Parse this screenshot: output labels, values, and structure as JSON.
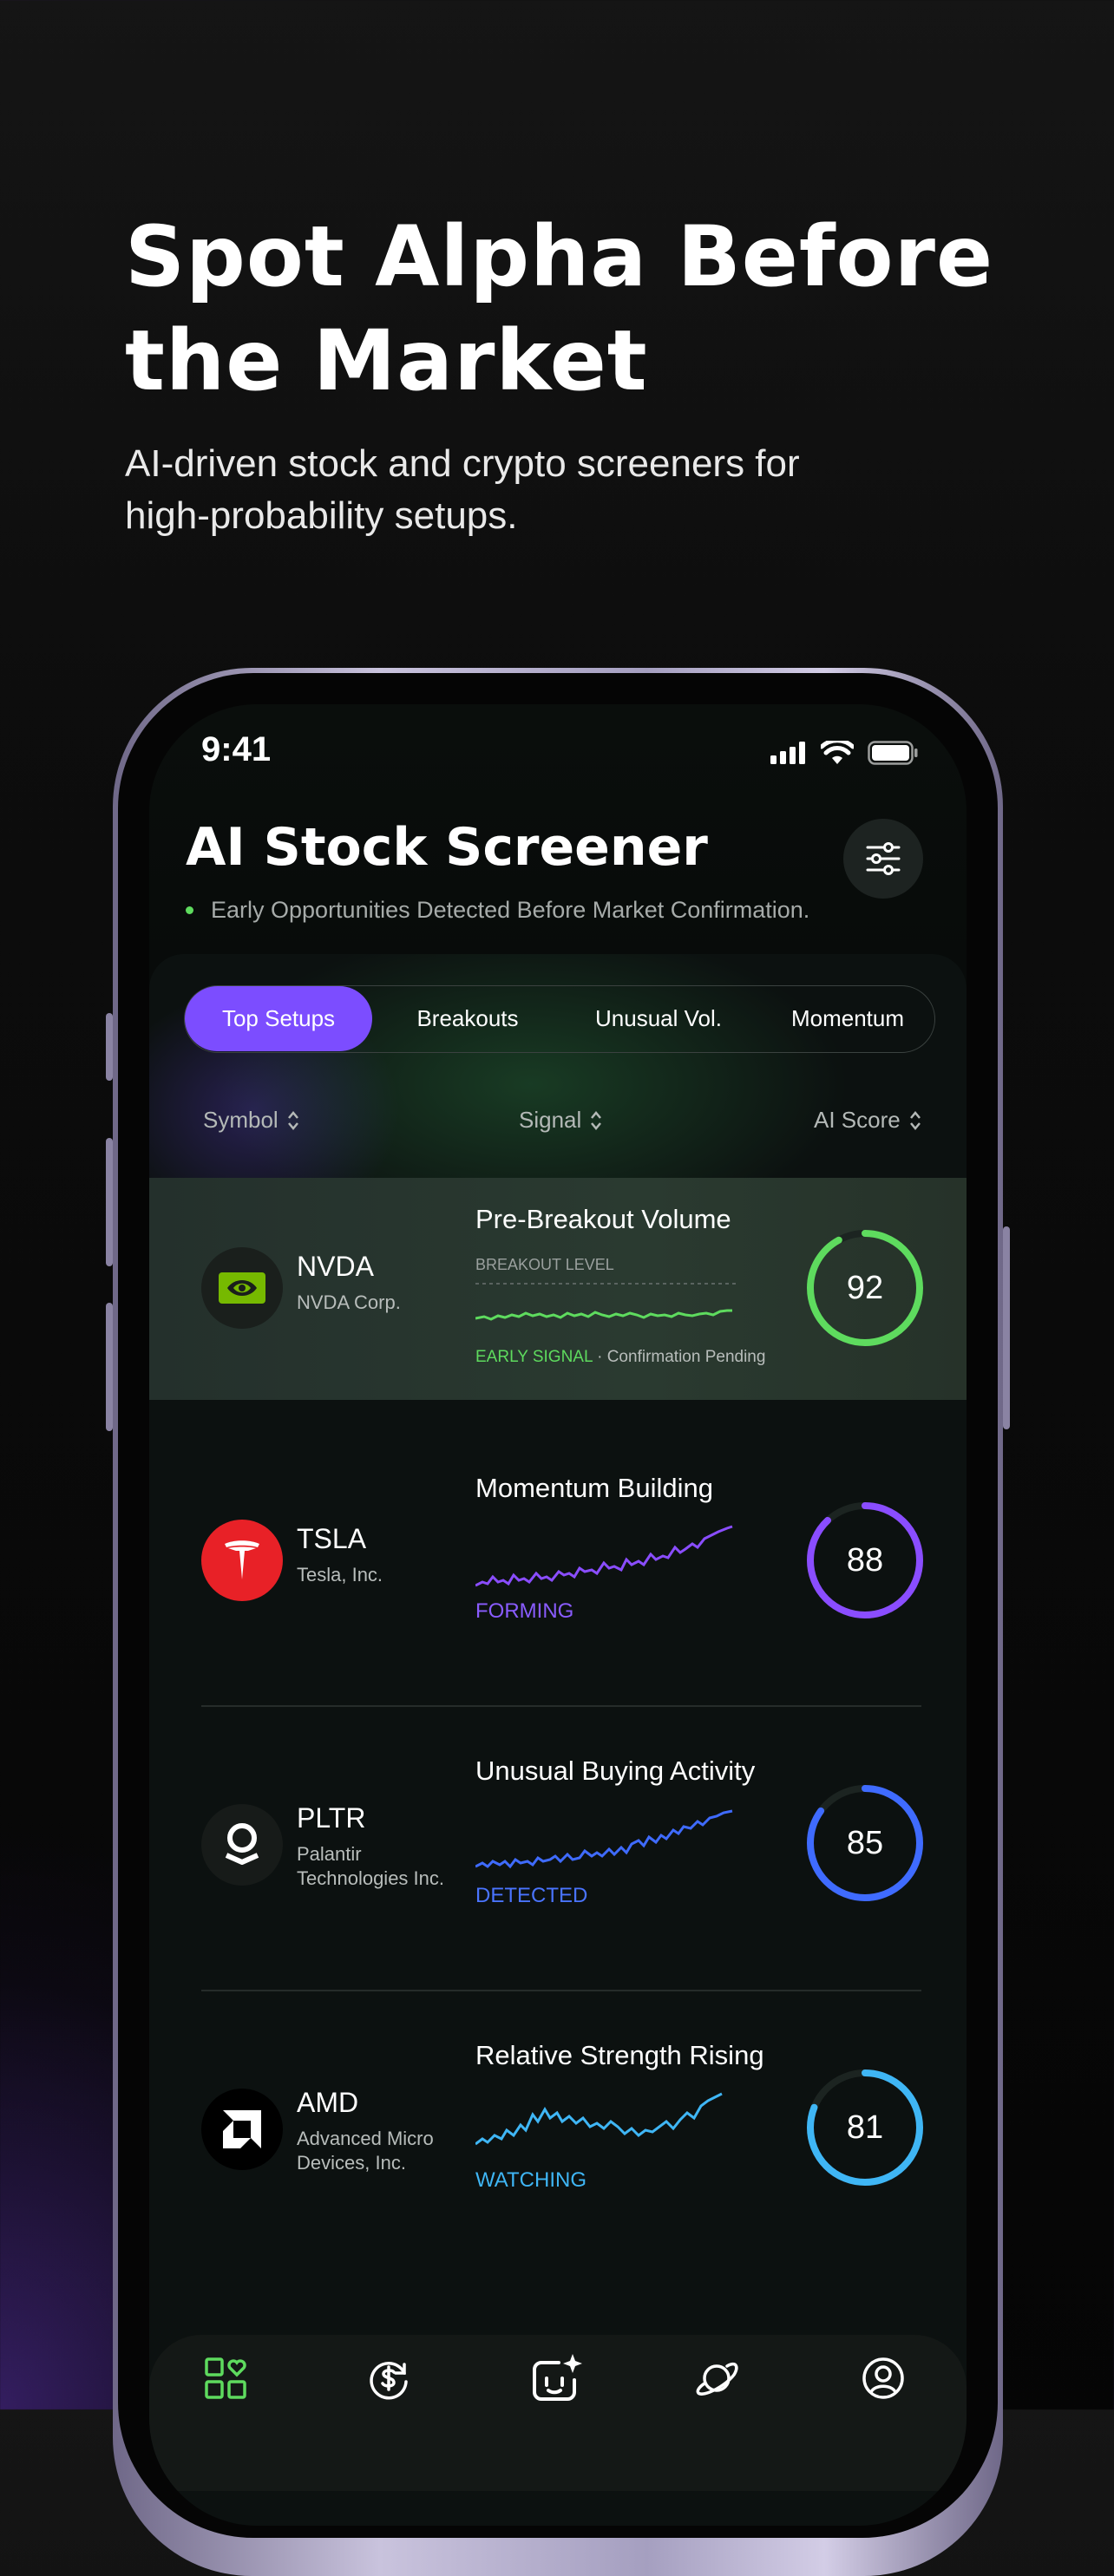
{
  "hero": {
    "title_line1": "Spot Alpha Before",
    "title_line2": "the Market",
    "subtitle_line1": "AI-driven stock and crypto screeners for",
    "subtitle_line2": "high-probability setups."
  },
  "status_bar": {
    "time": "9:41"
  },
  "app": {
    "title": "AI Stock Screener",
    "subtitle": "Early Opportunities Detected Before Market Confirmation."
  },
  "tabs": [
    {
      "label": "Top Setups",
      "active": true
    },
    {
      "label": "Breakouts",
      "active": false
    },
    {
      "label": "Unusual Vol.",
      "active": false
    },
    {
      "label": "Momentum",
      "active": false
    }
  ],
  "columns": {
    "symbol": "Symbol",
    "signal": "Signal",
    "ai_score": "AI Score"
  },
  "rows": [
    {
      "symbol": "NVDA",
      "company": "NVDA Corp.",
      "signal_title": "Pre-Breakout Volume",
      "breakout_label": "BREAKOUT LEVEL",
      "status": "EARLY SIGNAL",
      "status_suffix": " · Confirmation Pending",
      "status_color": "#5edb5e",
      "score": 92,
      "score_color": "#5edb5e"
    },
    {
      "symbol": "TSLA",
      "company": "Tesla, Inc.",
      "signal_title": "Momentum Building",
      "status": "FORMING",
      "status_color": "#8a5cff",
      "score": 88,
      "score_color": "#8a4dff"
    },
    {
      "symbol": "PLTR",
      "company": "Palantir Technologies Inc.",
      "signal_title": "Unusual Buying Activity",
      "status": "DETECTED",
      "status_color": "#4a74ff",
      "score": 85,
      "score_color": "#3f6bff"
    },
    {
      "symbol": "AMD",
      "company": "Advanced Micro Devices, Inc.",
      "signal_title": "Relative Strength Rising",
      "status": "WATCHING",
      "status_color": "#3fb6f5",
      "score": 81,
      "score_color": "#3fb6f5"
    }
  ],
  "bottom_nav": [
    {
      "icon": "dashboard-heart-icon",
      "active": true
    },
    {
      "icon": "dollar-refresh-icon",
      "active": false
    },
    {
      "icon": "ai-sparkle-icon",
      "active": false
    },
    {
      "icon": "planet-icon",
      "active": false
    },
    {
      "icon": "profile-icon",
      "active": false
    }
  ]
}
